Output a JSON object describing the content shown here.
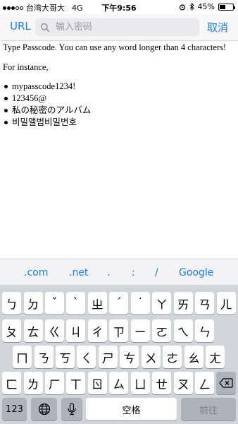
{
  "status_bar": {
    "carrier": "台湾大哥大",
    "network": "4G",
    "time": "下午9:56",
    "battery": "45%",
    "battery_fraction": 0.45
  },
  "nav": {
    "left_button": "URL",
    "search_placeholder": "输入密码",
    "right_button": "取消"
  },
  "content": {
    "intro": "Type Passcode. You can use any word longer than 4 characters!",
    "instance": "For instance,",
    "examples": [
      "mypasscode1234!",
      "123456@",
      "私の秘密のアルバム",
      "비밀앨범비밀번호"
    ]
  },
  "suggestions": [
    ".com",
    ".net",
    ".",
    ":",
    "/",
    "Google"
  ],
  "keyboard": {
    "row1": [
      "ㄅ",
      "ㄉ",
      "ˇ",
      "ˋ",
      "ㄓ",
      "ˊ",
      "˙",
      "ㄚ",
      "ㄞ",
      "ㄢ",
      "ㄦ"
    ],
    "row2": [
      "ㄆ",
      "ㄊ",
      "ㄍ",
      "ㄐ",
      "ㄔ",
      "ㄗ",
      "ㄧ",
      "ㄛ",
      "ㄟ",
      "ㄣ"
    ],
    "row3": [
      "ㄇ",
      "ㄋ",
      "ㄎ",
      "ㄑ",
      "ㄕ",
      "ㄘ",
      "ㄨ",
      "ㄜ",
      "ㄠ",
      "ㄤ"
    ],
    "row4": [
      "ㄈ",
      "ㄌ",
      "ㄏ",
      "ㄒ",
      "ㄖ",
      "ㄙ",
      "ㄩ",
      "ㄝ",
      "ㄡ",
      "ㄥ"
    ],
    "numbers_label": "123",
    "space_label": "空格",
    "go_label": "前往",
    "icons": {
      "globe": "globe-icon",
      "mic": "microphone-icon",
      "backspace": "backspace-icon"
    }
  }
}
